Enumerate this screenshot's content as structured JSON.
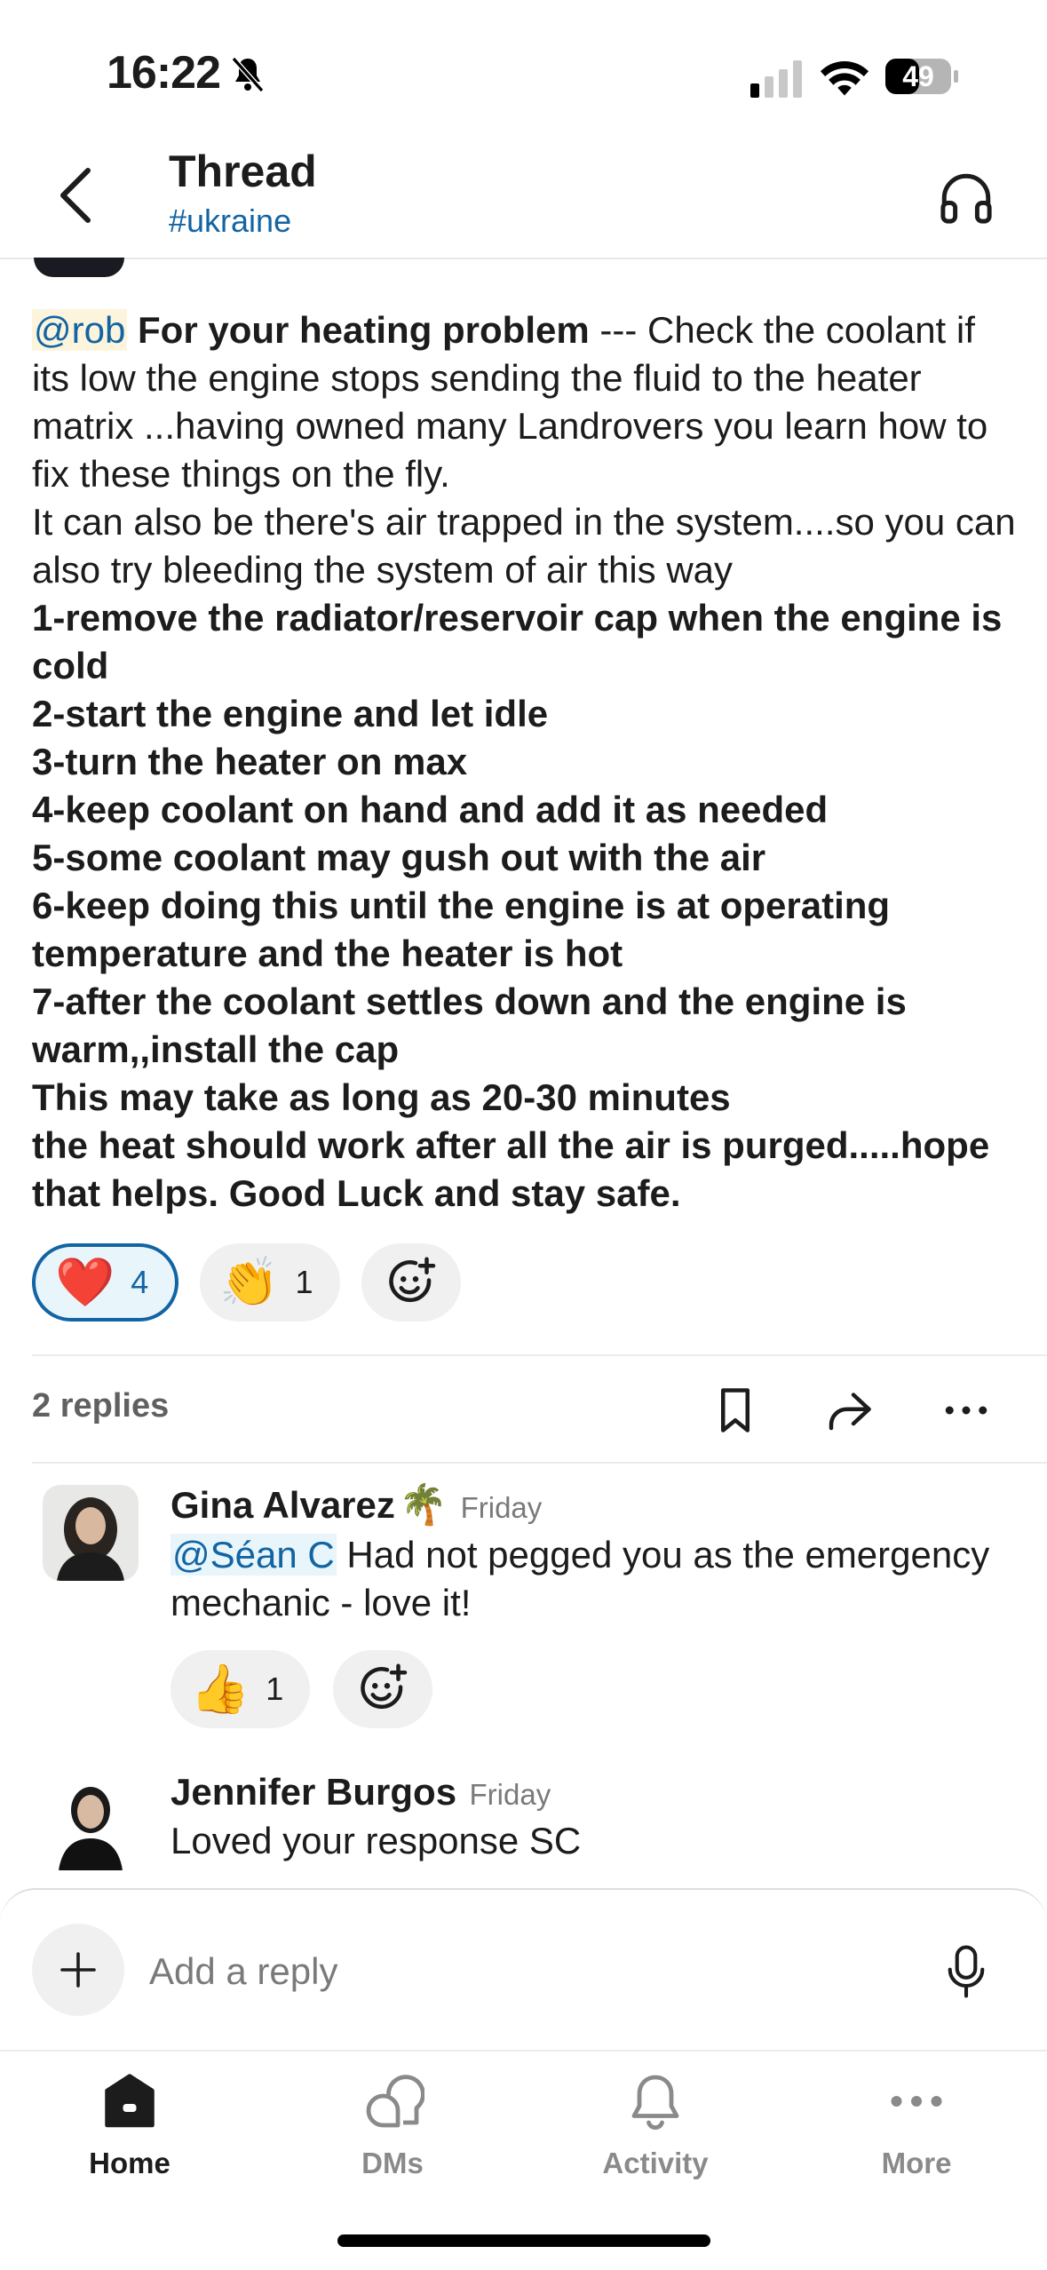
{
  "status_bar": {
    "time": "16:22",
    "battery": "49"
  },
  "header": {
    "title": "Thread",
    "channel": "#ukraine"
  },
  "message": {
    "mention": "@rob",
    "bold_intro": "For your heating problem",
    "intro_rest": "--- Check the coolant if its low the engine stops sending the fluid to the heater matrix ...having owned many Landrovers you learn how to fix these things on the fly.",
    "line2": "It can also be there's air trapped in the system....so you can also try bleeding the system of air this way",
    "steps": [
      "1-remove the radiator/reservoir cap when the engine is cold",
      "2-start the engine and let idle",
      "3-turn the heater on max",
      "4-keep coolant on hand and add it as needed",
      "5-some coolant may gush out with the air",
      "6-keep doing this until the engine is at operating temperature and the heater is hot",
      "7-after the coolant settles down and the engine is warm,,install the cap",
      "This may take as long as 20-30 minutes",
      "the heat should work after all the air is purged.....hope that helps. Good Luck and stay safe."
    ],
    "reactions": [
      {
        "emoji": "❤️",
        "count": "4",
        "active": true
      },
      {
        "emoji": "👏",
        "count": "1",
        "active": false
      }
    ]
  },
  "reply_bar": {
    "count_label": "2 replies"
  },
  "replies": [
    {
      "name": "Gina Alvarez",
      "status_emoji": "🌴",
      "time": "Friday",
      "mention": "@Séan C",
      "text": "Had not pegged you as the emergency mechanic - love it!",
      "reactions": [
        {
          "emoji": "👍",
          "count": "1"
        }
      ]
    },
    {
      "name": "Jennifer Burgos",
      "time": "Friday",
      "text": "Loved your response SC"
    }
  ],
  "composer": {
    "placeholder": "Add a reply"
  },
  "tabbar": {
    "home": "Home",
    "dms": "DMs",
    "activity": "Activity",
    "more": "More"
  },
  "colors": {
    "link": "#1264a3",
    "mention_highlight": "#fcf4dc",
    "text": "#1d1c1d",
    "muted": "#616061"
  }
}
